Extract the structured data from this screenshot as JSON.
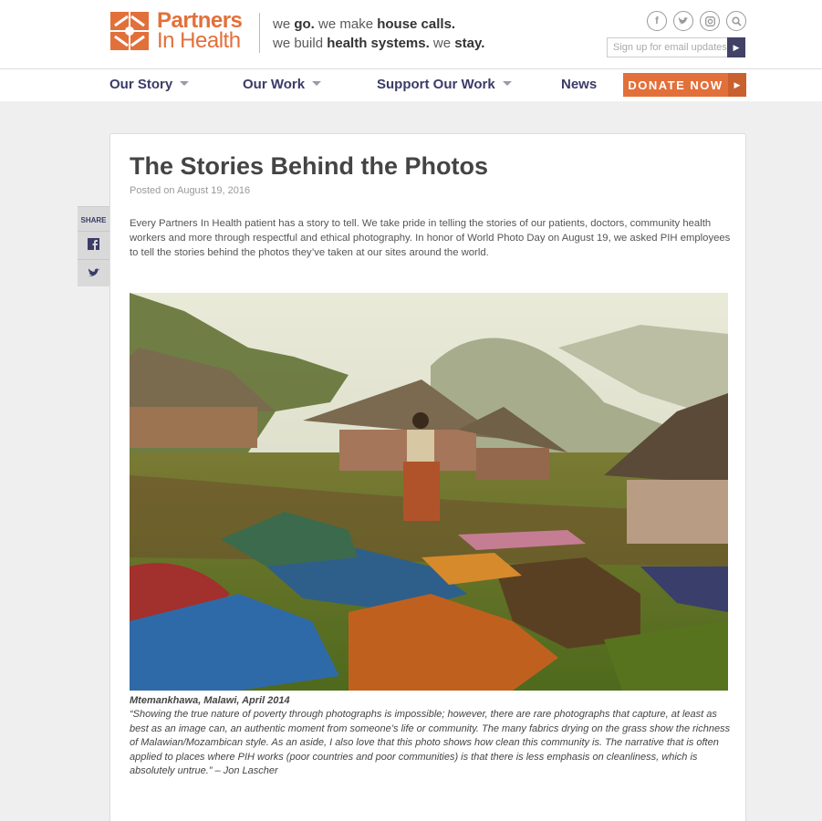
{
  "header": {
    "logo_line1": "Partners",
    "logo_line2": "In Health",
    "tagline": {
      "l1_a": "we ",
      "l1_b": "go.",
      "l1_c": " we make ",
      "l1_d": "house calls.",
      "l2_a": "we build ",
      "l2_b": "health systems.",
      "l2_c": " we ",
      "l2_d": "stay."
    },
    "social_icons": [
      "facebook-icon",
      "twitter-icon",
      "instagram-icon",
      "search-icon"
    ],
    "signup_placeholder": "Sign up for email updates"
  },
  "nav": {
    "items": [
      {
        "label": "Our Story"
      },
      {
        "label": "Our Work"
      },
      {
        "label": "Support Our Work"
      },
      {
        "label": "News"
      }
    ],
    "donate_label": "DONATE NOW"
  },
  "share": {
    "label": "SHARE",
    "icons": [
      "facebook-icon",
      "twitter-icon"
    ]
  },
  "article": {
    "title": "The Stories Behind the Photos",
    "posted": "Posted on August 19, 2016",
    "intro": "Every Partners In Health patient has a story to tell. We take pride in telling the stories of our patients, doctors, community health workers and more through respectful and ethical photography. In honor of World Photo Day on August 19, we asked PIH employees to tell the stories behind the photos they’ve taken at our sites around the world.",
    "caption_place": "Mtemankhawa, Malawi, April 2014",
    "caption_text": "“Showing the true nature of poverty through photographs is impossible; however, there are rare photographs that capture, at least as best as an image can, an authentic moment from someone’s life or community. The many fabrics drying on the grass show the richness of Malawian/Mozambican style. As an aside, I also love that this photo shows how clean this community is. The narrative that is often applied to places where PIH works (poor countries and poor communities) is that there is less emphasis on cleanliness, which is absolutely untrue.” – Jon Lascher"
  },
  "colors": {
    "brand_orange": "#e2703a",
    "nav_navy": "#3a3c67",
    "background": "#efefef"
  }
}
